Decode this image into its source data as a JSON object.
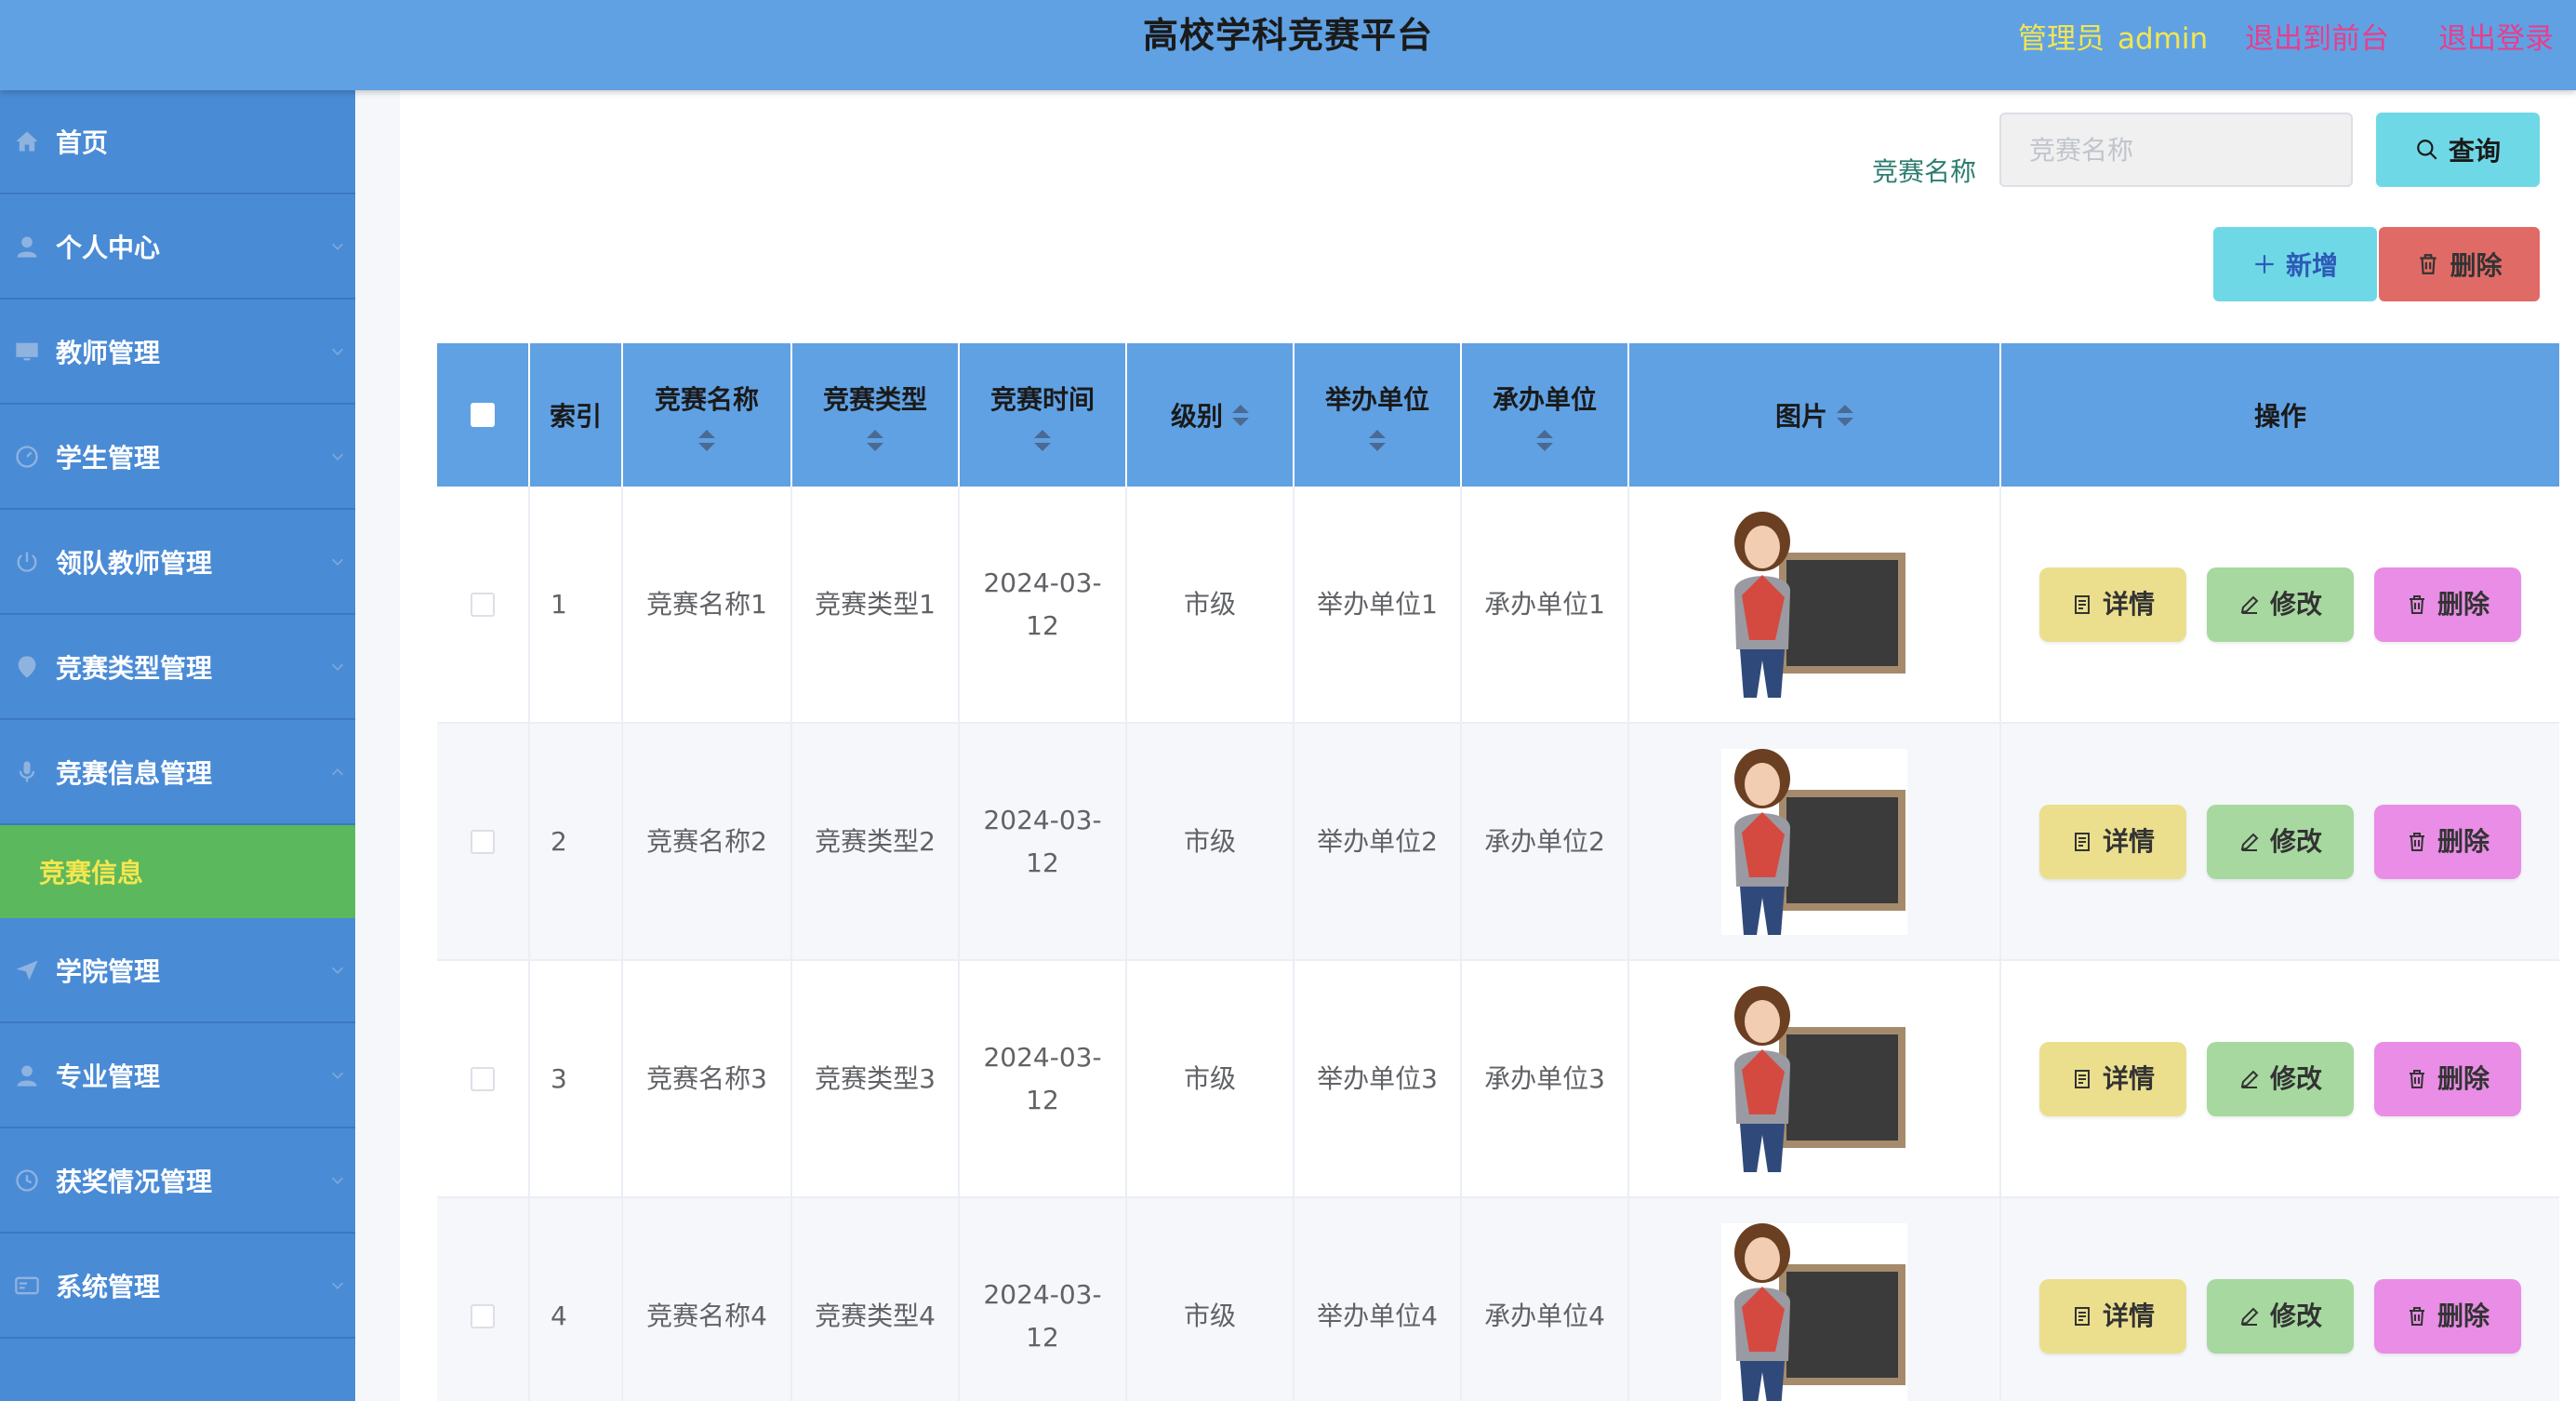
{
  "header": {
    "title": "高校学科竞赛平台",
    "admin_role": "管理员",
    "admin_name": "admin",
    "front_link": "退出到前台",
    "logout_link": "退出登录"
  },
  "sidebar": {
    "items": [
      {
        "label": "首页",
        "icon": "home-icon"
      },
      {
        "label": "个人中心",
        "icon": "user-icon"
      },
      {
        "label": "教师管理",
        "icon": "monitor-icon"
      },
      {
        "label": "学生管理",
        "icon": "gauge-icon"
      },
      {
        "label": "领队教师管理",
        "icon": "power-icon"
      },
      {
        "label": "竞赛类型管理",
        "icon": "location-icon"
      },
      {
        "label": "竞赛信息管理",
        "icon": "microphone-icon"
      },
      {
        "label": "学院管理",
        "icon": "send-icon"
      },
      {
        "label": "专业管理",
        "icon": "user-icon"
      },
      {
        "label": "获奖情况管理",
        "icon": "clock-icon"
      },
      {
        "label": "系统管理",
        "icon": "card-icon"
      }
    ],
    "active_sub": "竞赛信息"
  },
  "search": {
    "label": "竞赛名称",
    "placeholder": "竞赛名称",
    "value": "",
    "query_label": "查询"
  },
  "toolbar": {
    "add_label": "新增",
    "delete_label": "删除"
  },
  "table": {
    "headers": {
      "index": "索引",
      "name": "竞赛名称",
      "type": "竞赛类型",
      "time": "竞赛时间",
      "level": "级别",
      "organizer": "举办单位",
      "undertaker": "承办单位",
      "image": "图片",
      "ops": "操作"
    },
    "rows": [
      {
        "index": "1",
        "name": "竞赛名称1",
        "type": "竞赛类型1",
        "time": "2024-03-12",
        "level": "市级",
        "organizer": "举办单位1",
        "undertaker": "承办单位1"
      },
      {
        "index": "2",
        "name": "竞赛名称2",
        "type": "竞赛类型2",
        "time": "2024-03-12",
        "level": "市级",
        "organizer": "举办单位2",
        "undertaker": "承办单位2"
      },
      {
        "index": "3",
        "name": "竞赛名称3",
        "type": "竞赛类型3",
        "time": "2024-03-12",
        "level": "市级",
        "organizer": "举办单位3",
        "undertaker": "承办单位3"
      },
      {
        "index": "4",
        "name": "竞赛名称4",
        "type": "竞赛类型4",
        "time": "2024-03-12",
        "level": "市级",
        "organizer": "举办单位4",
        "undertaker": "承办单位4"
      }
    ],
    "row_actions": {
      "detail": "详情",
      "edit": "修改",
      "delete": "删除"
    }
  },
  "colors": {
    "header_bg": "#60a1e3",
    "sidebar_bg": "#4a8bd6",
    "active_sub_bg": "#5cb85c",
    "accent_yellow": "#f5e64f",
    "link_pink": "#e83e8c"
  }
}
